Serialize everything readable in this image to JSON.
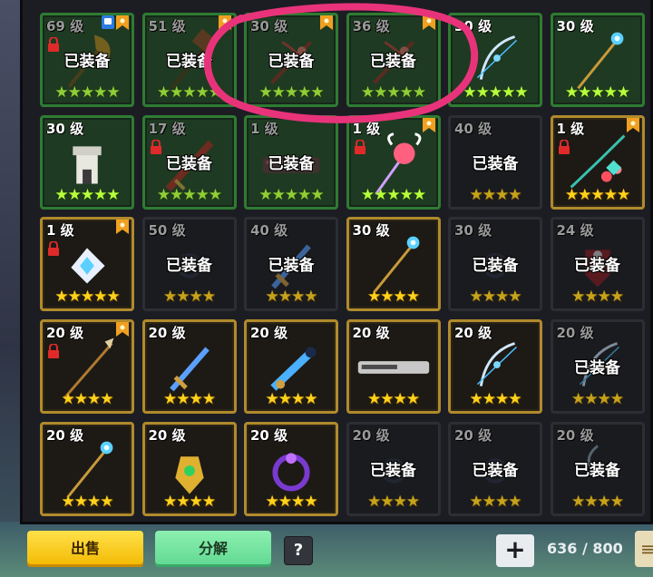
{
  "equipped_label": "已装备",
  "star_char": "★",
  "slots": [
    {
      "level": "69 级",
      "equipped": true,
      "frame": "green",
      "stars": 5,
      "locked": true,
      "ribbon": true,
      "badge": true,
      "icon": "axe-icon"
    },
    {
      "level": "51 级",
      "equipped": true,
      "frame": "green",
      "stars": 5,
      "locked": false,
      "ribbon": true,
      "badge": false,
      "icon": "hammer-icon"
    },
    {
      "level": "30 级",
      "equipped": true,
      "frame": "green",
      "stars": 5,
      "locked": false,
      "ribbon": true,
      "badge": false,
      "icon": "crossbow-icon"
    },
    {
      "level": "36 级",
      "equipped": true,
      "frame": "green",
      "stars": 5,
      "locked": false,
      "ribbon": true,
      "badge": false,
      "icon": "crossbow-icon"
    },
    {
      "level": "30 级",
      "equipped": false,
      "frame": "green",
      "stars": 5,
      "locked": false,
      "ribbon": false,
      "badge": false,
      "icon": "bow-icon"
    },
    {
      "level": "30 级",
      "equipped": false,
      "frame": "green",
      "stars": 5,
      "locked": false,
      "ribbon": false,
      "badge": false,
      "icon": "staff-icon"
    },
    {
      "level": "30 级",
      "equipped": false,
      "frame": "green",
      "stars": 5,
      "locked": false,
      "ribbon": false,
      "badge": false,
      "icon": "tower-icon"
    },
    {
      "level": "17 级",
      "equipped": true,
      "frame": "green",
      "stars": 5,
      "locked": true,
      "ribbon": false,
      "badge": false,
      "icon": "greatsword-icon"
    },
    {
      "level": "1 级",
      "equipped": true,
      "frame": "green",
      "stars": 5,
      "locked": false,
      "ribbon": false,
      "badge": false,
      "icon": "cannon-icon"
    },
    {
      "level": "1 级",
      "equipped": false,
      "frame": "green",
      "stars": 5,
      "locked": true,
      "ribbon": true,
      "badge": false,
      "icon": "wand-icon"
    },
    {
      "level": "40 级",
      "equipped": true,
      "frame": "dark",
      "stars": 4,
      "locked": false,
      "ribbon": false,
      "badge": false,
      "icon": "blank-icon"
    },
    {
      "level": "1 级",
      "equipped": false,
      "frame": "gold",
      "stars": 5,
      "locked": true,
      "ribbon": true,
      "badge": false,
      "icon": "flower-bow-icon"
    },
    {
      "level": "1 级",
      "equipped": false,
      "frame": "gold",
      "stars": 5,
      "locked": true,
      "ribbon": true,
      "badge": false,
      "icon": "crystal-icon"
    },
    {
      "level": "50 级",
      "equipped": true,
      "frame": "dark",
      "stars": 4,
      "locked": false,
      "ribbon": false,
      "badge": false,
      "icon": "orb-icon"
    },
    {
      "level": "40 级",
      "equipped": true,
      "frame": "dark",
      "stars": 4,
      "locked": false,
      "ribbon": false,
      "badge": false,
      "icon": "sword-icon"
    },
    {
      "level": "30 级",
      "equipped": false,
      "frame": "gold",
      "stars": 4,
      "locked": false,
      "ribbon": false,
      "badge": false,
      "icon": "staff-icon"
    },
    {
      "level": "30 级",
      "equipped": true,
      "frame": "dark",
      "stars": 4,
      "locked": false,
      "ribbon": false,
      "badge": false,
      "icon": "orb-icon"
    },
    {
      "level": "24 级",
      "equipped": true,
      "frame": "dark",
      "stars": 4,
      "locked": false,
      "ribbon": false,
      "badge": false,
      "icon": "shield-icon"
    },
    {
      "level": "20 级",
      "equipped": false,
      "frame": "gold",
      "stars": 4,
      "locked": true,
      "ribbon": true,
      "badge": false,
      "icon": "spear-icon"
    },
    {
      "level": "20 级",
      "equipped": false,
      "frame": "gold",
      "stars": 4,
      "locked": false,
      "ribbon": false,
      "badge": false,
      "icon": "sword-icon"
    },
    {
      "level": "20 级",
      "equipped": false,
      "frame": "gold",
      "stars": 4,
      "locked": false,
      "ribbon": false,
      "badge": false,
      "icon": "blaster-icon"
    },
    {
      "level": "20 级",
      "equipped": false,
      "frame": "gold",
      "stars": 4,
      "locked": false,
      "ribbon": false,
      "badge": false,
      "icon": "rifle-icon"
    },
    {
      "level": "20 级",
      "equipped": false,
      "frame": "gold",
      "stars": 4,
      "locked": false,
      "ribbon": false,
      "badge": false,
      "icon": "bow-icon"
    },
    {
      "level": "20 级",
      "equipped": true,
      "frame": "dark",
      "stars": 4,
      "locked": false,
      "ribbon": false,
      "badge": false,
      "icon": "bow-icon"
    },
    {
      "level": "20 级",
      "equipped": false,
      "frame": "gold",
      "stars": 4,
      "locked": false,
      "ribbon": false,
      "badge": false,
      "icon": "staff-icon"
    },
    {
      "level": "20 级",
      "equipped": false,
      "frame": "gold",
      "stars": 4,
      "locked": false,
      "ribbon": false,
      "badge": false,
      "icon": "gem-icon"
    },
    {
      "level": "20 级",
      "equipped": false,
      "frame": "gold",
      "stars": 4,
      "locked": false,
      "ribbon": false,
      "badge": false,
      "icon": "ring-icon"
    },
    {
      "level": "20 级",
      "equipped": true,
      "frame": "dark",
      "stars": 4,
      "locked": false,
      "ribbon": false,
      "badge": false,
      "icon": "orb-icon"
    },
    {
      "level": "20 级",
      "equipped": true,
      "frame": "dark",
      "stars": 4,
      "locked": false,
      "ribbon": false,
      "badge": false,
      "icon": "orb-icon"
    },
    {
      "level": "20 级",
      "equipped": true,
      "frame": "dark",
      "stars": 4,
      "locked": false,
      "ribbon": false,
      "badge": false,
      "icon": "hook-icon"
    }
  ],
  "footer": {
    "sell_label": "出售",
    "disassemble_label": "分解",
    "help_label": "?",
    "expand_label": "+",
    "capacity_used": "636",
    "capacity_separator": "/",
    "capacity_total": "800"
  },
  "colors": {
    "green_frame": "#2f7b33",
    "gold_frame": "#b08a2c",
    "dark_frame": "#2d2e34",
    "annotation_circle": "#e8337a"
  }
}
